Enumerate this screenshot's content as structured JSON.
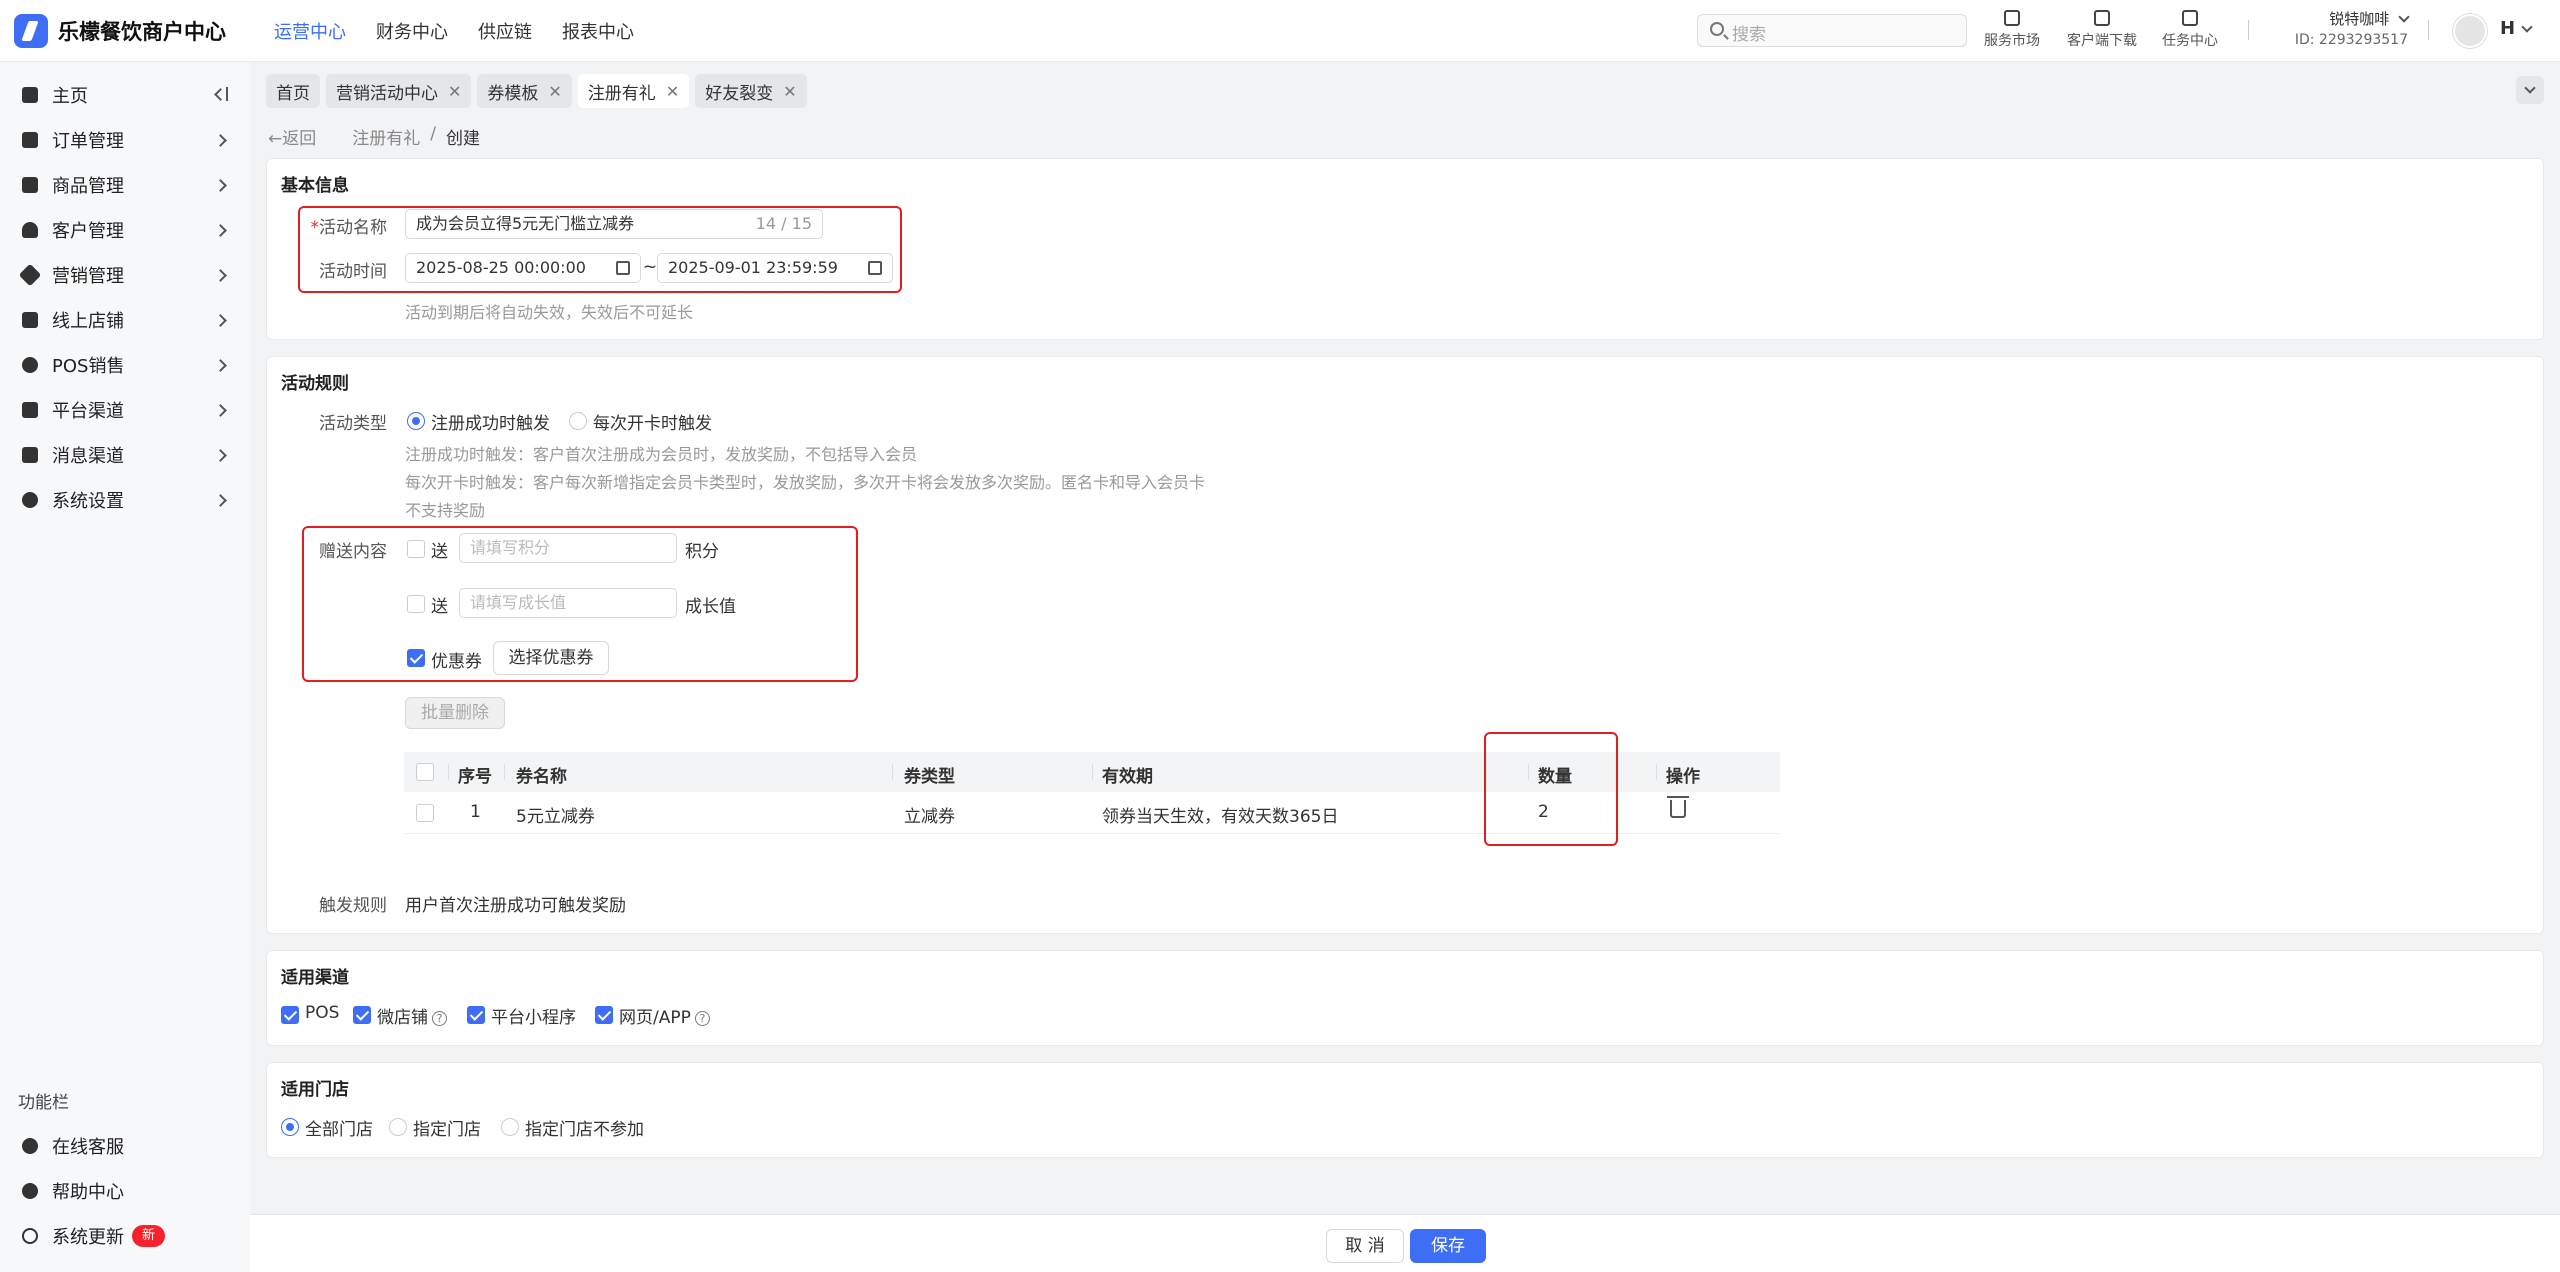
{
  "app": {
    "title": "乐檬餐饮商户中心"
  },
  "topnav": [
    "运营中心",
    "财务中心",
    "供应链",
    "报表中心"
  ],
  "search": {
    "placeholder": "搜索"
  },
  "tools": [
    "服务市场",
    "客户端下载",
    "任务中心"
  ],
  "account": {
    "name": "锐特咖啡",
    "id": "ID: 2293293517",
    "initial": "H"
  },
  "sidebar": {
    "items": [
      "主页",
      "订单管理",
      "商品管理",
      "客户管理",
      "营销管理",
      "线上店铺",
      "POS销售",
      "平台渠道",
      "消息渠道",
      "系统设置"
    ],
    "func_title": "功能栏",
    "func_items": [
      "在线客服",
      "帮助中心",
      "系统更新"
    ],
    "new_badge": "新"
  },
  "tabs": [
    "首页",
    "营销活动中心",
    "券模板",
    "注册有礼",
    "好友裂变"
  ],
  "breadcrumb": {
    "back": "返回",
    "parent": "注册有礼",
    "sep": "/",
    "current": "创建"
  },
  "basic": {
    "title": "基本信息",
    "name_label": "活动名称",
    "name_value": "成为会员立得5元无门槛立减券",
    "name_count": "14 / 15",
    "time_label": "活动时间",
    "start": "2025-08-25 00:00:00",
    "tilde": "~",
    "end": "2025-09-01 23:59:59",
    "hint": "活动到期后将自动失效，失效后不可延长"
  },
  "rules": {
    "title": "活动规则",
    "type_label": "活动类型",
    "type_opt1": "注册成功时触发",
    "type_opt2": "每次开卡时触发",
    "hint1": "注册成功时触发：客户首次注册成为会员时，发放奖励，不包括导入会员",
    "hint2": "每次开卡时触发：客户每次新增指定会员卡类型时，发放奖励，多次开卡将会发放多次奖励。匿名卡和导入会员卡",
    "hint3": "不支持奖励",
    "gift_label": "赠送内容",
    "send": "送",
    "points_placeholder": "请填写积分",
    "points_unit": "积分",
    "growth_placeholder": "请填写成长值",
    "growth_unit": "成长值",
    "coupon_label": "优惠券",
    "select_coupon": "选择优惠券",
    "batch_delete": "批量删除",
    "table": {
      "headers": [
        "序号",
        "券名称",
        "券类型",
        "有效期",
        "数量",
        "操作"
      ],
      "rows": [
        {
          "no": "1",
          "name": "5元立减券",
          "type": "立减券",
          "validity": "领券当天生效，有效天数365日",
          "qty": "2"
        }
      ]
    },
    "trigger_label": "触发规则",
    "trigger_value": "用户首次注册成功可触发奖励"
  },
  "channels": {
    "title": "适用渠道",
    "items": [
      "POS",
      "微店铺",
      "平台小程序",
      "网页/APP"
    ]
  },
  "stores": {
    "title": "适用门店",
    "options": [
      "全部门店",
      "指定门店",
      "指定门店不参加"
    ]
  },
  "footer": {
    "cancel": "取 消",
    "save": "保存"
  },
  "colors": {
    "accent": "#3d6ef5",
    "highlight": "#e02020"
  }
}
